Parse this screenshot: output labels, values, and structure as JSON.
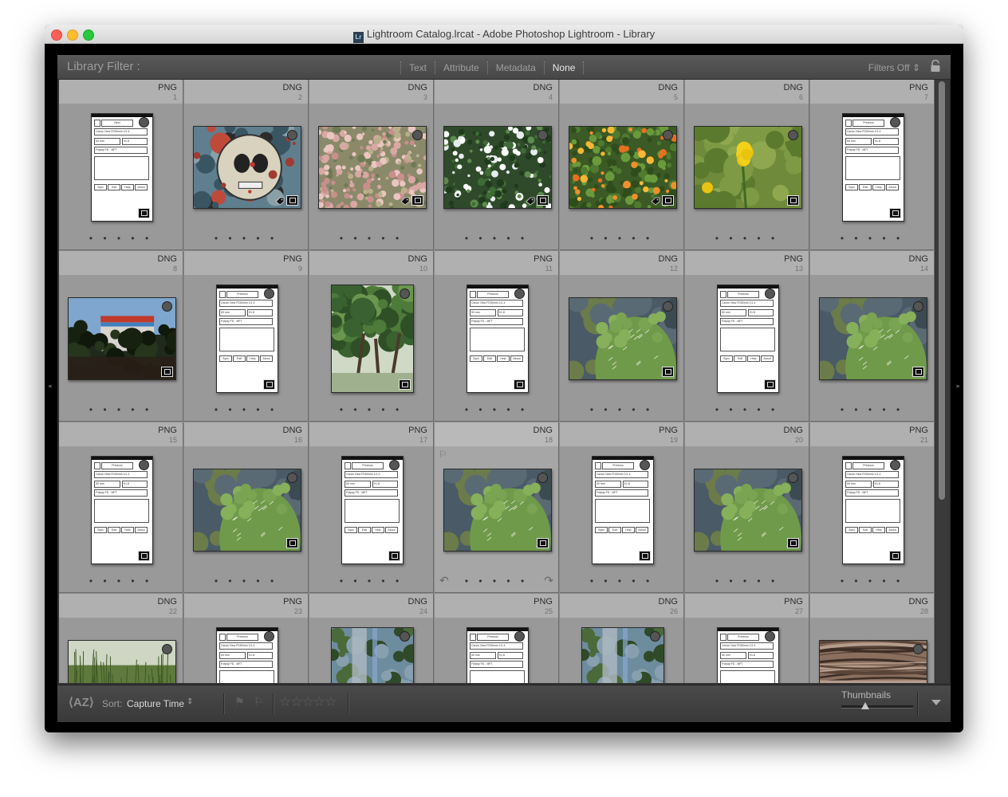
{
  "window": {
    "title": "Lightroom Catalog.lrcat - Adobe Photoshop Lightroom - Library",
    "app_icon": "Lr"
  },
  "filter_bar": {
    "label": "Library Filter :",
    "tabs": [
      "Text",
      "Attribute",
      "Metadata",
      "None"
    ],
    "active_tab": "None",
    "preset": "Filters Off"
  },
  "grid": {
    "cells": [
      {
        "type": "PNG",
        "index": "1",
        "kind": "phone",
        "phone_header": "Next"
      },
      {
        "type": "DNG",
        "index": "2",
        "kind": "photo",
        "scene": "skull",
        "tag": true
      },
      {
        "type": "DNG",
        "index": "3",
        "kind": "photo",
        "scene": "pink",
        "tag": true
      },
      {
        "type": "DNG",
        "index": "4",
        "kind": "photo",
        "scene": "greenwhite",
        "tag": true
      },
      {
        "type": "DNG",
        "index": "5",
        "kind": "photo",
        "scene": "orange",
        "tag": true
      },
      {
        "type": "DNG",
        "index": "6",
        "kind": "photo",
        "scene": "yellow"
      },
      {
        "type": "PNG",
        "index": "7",
        "kind": "phone",
        "phone_header": "Previous"
      },
      {
        "type": "DNG",
        "index": "8",
        "kind": "photo",
        "scene": "building"
      },
      {
        "type": "PNG",
        "index": "9",
        "kind": "phone",
        "phone_header": "Previous"
      },
      {
        "type": "DNG",
        "index": "10",
        "kind": "photo_portrait",
        "scene": "trees"
      },
      {
        "type": "PNG",
        "index": "11",
        "kind": "phone",
        "phone_header": "Previous"
      },
      {
        "type": "DNG",
        "index": "12",
        "kind": "photo",
        "scene": "cactus"
      },
      {
        "type": "PNG",
        "index": "13",
        "kind": "phone",
        "phone_header": "Previous"
      },
      {
        "type": "DNG",
        "index": "14",
        "kind": "photo",
        "scene": "cactus"
      },
      {
        "type": "PNG",
        "index": "15",
        "kind": "phone",
        "phone_header": "Previous"
      },
      {
        "type": "DNG",
        "index": "16",
        "kind": "photo",
        "scene": "cactus"
      },
      {
        "type": "PNG",
        "index": "17",
        "kind": "phone",
        "phone_header": "Previous"
      },
      {
        "type": "DNG",
        "index": "18",
        "kind": "photo",
        "scene": "cactus",
        "selected": true
      },
      {
        "type": "PNG",
        "index": "19",
        "kind": "phone",
        "phone_header": "Previous"
      },
      {
        "type": "DNG",
        "index": "20",
        "kind": "photo",
        "scene": "cactus"
      },
      {
        "type": "PNG",
        "index": "21",
        "kind": "phone",
        "phone_header": "Previous"
      },
      {
        "type": "DNG",
        "index": "22",
        "kind": "photo",
        "scene": "grass"
      },
      {
        "type": "PNG",
        "index": "23",
        "kind": "phone",
        "phone_header": "Previous"
      },
      {
        "type": "DNG",
        "index": "24",
        "kind": "photo_portrait",
        "scene": "glass"
      },
      {
        "type": "PNG",
        "index": "25",
        "kind": "phone",
        "phone_header": "Previous"
      },
      {
        "type": "DNG",
        "index": "26",
        "kind": "photo_portrait",
        "scene": "glass"
      },
      {
        "type": "PNG",
        "index": "27",
        "kind": "phone",
        "phone_header": "Previous"
      },
      {
        "type": "DNG",
        "index": "28",
        "kind": "photo",
        "scene": "bark"
      }
    ],
    "phone_lines": [
      "Canon New FD50mm 1/1.4",
      "50 mm",
      "f/1.8",
      "Fotpay FD - MFT"
    ],
    "phone_buttons": [
      "Sync",
      "Edit",
      "Help",
      "About"
    ]
  },
  "toolbar": {
    "sort_label": "Sort:",
    "sort_value": "Capture Time",
    "thumbnails_label": "Thumbnails",
    "thumbnail_size_fraction": 0.33,
    "stars": "☆☆☆☆☆"
  }
}
